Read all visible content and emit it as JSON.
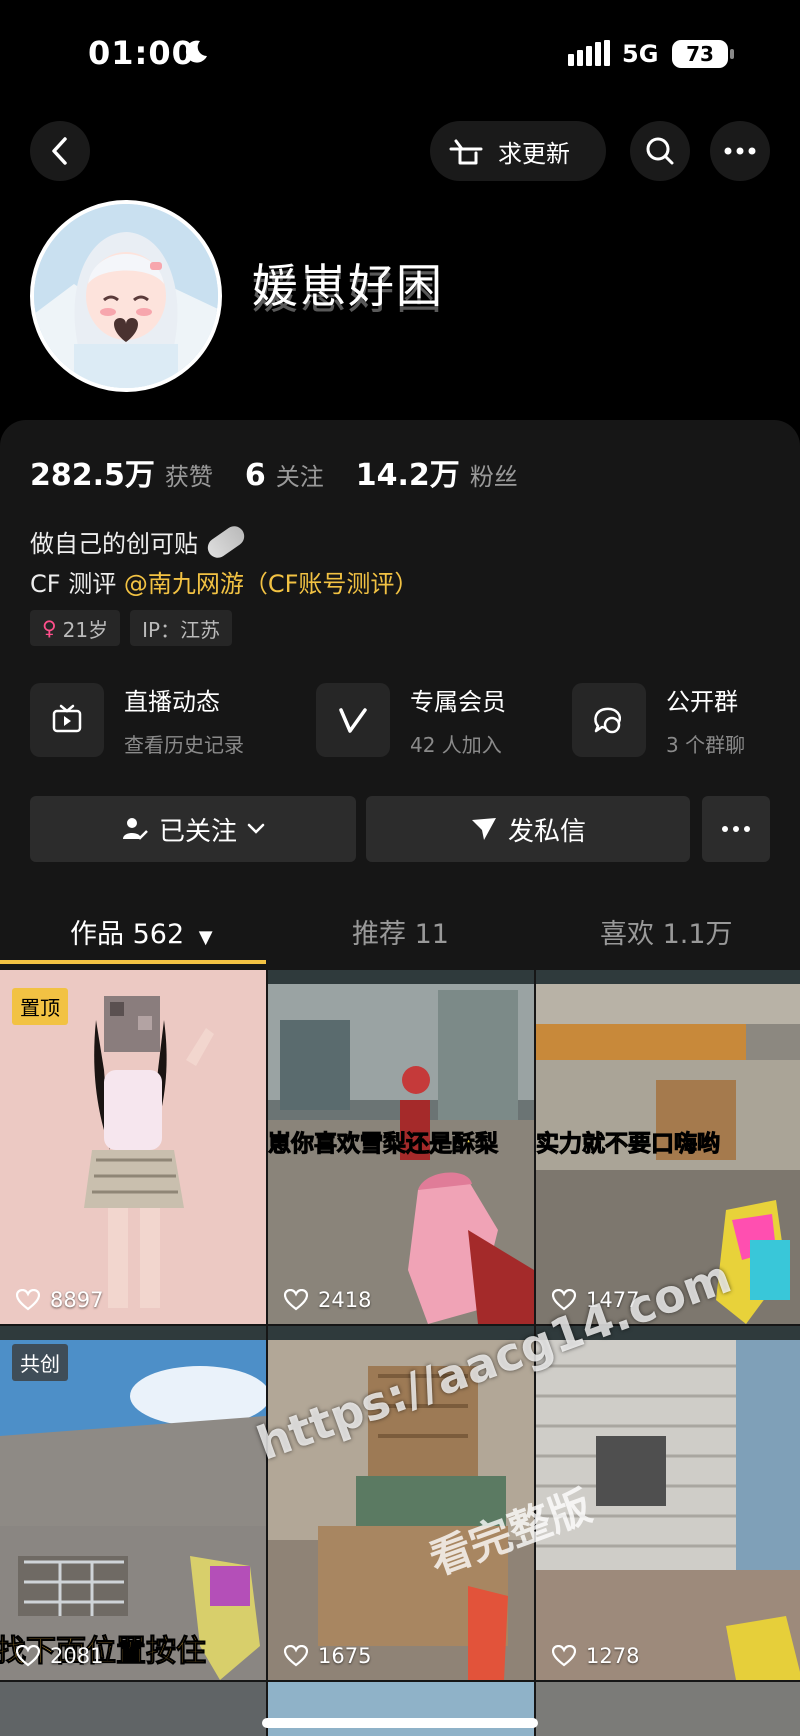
{
  "status_bar": {
    "time": "01:00",
    "network": "5G",
    "battery": "73"
  },
  "topbar": {
    "request_update_label": "求更新"
  },
  "profile": {
    "nickname": "媛崽好困"
  },
  "stats": [
    {
      "value": "282.5万",
      "label": "获赞"
    },
    {
      "value": "6",
      "label": "关注"
    },
    {
      "value": "14.2万",
      "label": "粉丝"
    }
  ],
  "bio": {
    "line1": "做自己的创可贴",
    "line2_prefix": "CF 测评 ",
    "line2_mention": "@南九网游（CF账号测评）"
  },
  "tags": {
    "age": "21岁",
    "ip": "IP：江苏"
  },
  "services": [
    {
      "title": "直播动态",
      "subtitle": "查看历史记录",
      "icon": "tv-icon"
    },
    {
      "title": "专属会员",
      "subtitle": "42 人加入",
      "icon": "v-icon"
    },
    {
      "title": "公开群",
      "subtitle": "3 个群聊",
      "icon": "chat-icon"
    }
  ],
  "actions": {
    "followed": "已关注",
    "message": "发私信"
  },
  "tabs": [
    {
      "label": "作品 562"
    },
    {
      "label": "推荐 11"
    },
    {
      "label": "喜欢 1.1万"
    }
  ],
  "videos": [
    {
      "likes": "8897",
      "badge": "置顶"
    },
    {
      "likes": "2418",
      "caption": "崽你喜欢雪梨还是酥梨"
    },
    {
      "likes": "1477",
      "caption": "实力就不要口嗨哟"
    },
    {
      "likes": "2081",
      "badge": "共创",
      "caption": "找下面位置按住"
    },
    {
      "likes": "1675"
    },
    {
      "likes": "1278"
    }
  ],
  "watermark": {
    "line1": "https://aacg14.com",
    "line2": "看完整版"
  },
  "colors": {
    "accent": "#f2c243",
    "panel": "#161616",
    "button": "#2c2c2c"
  }
}
